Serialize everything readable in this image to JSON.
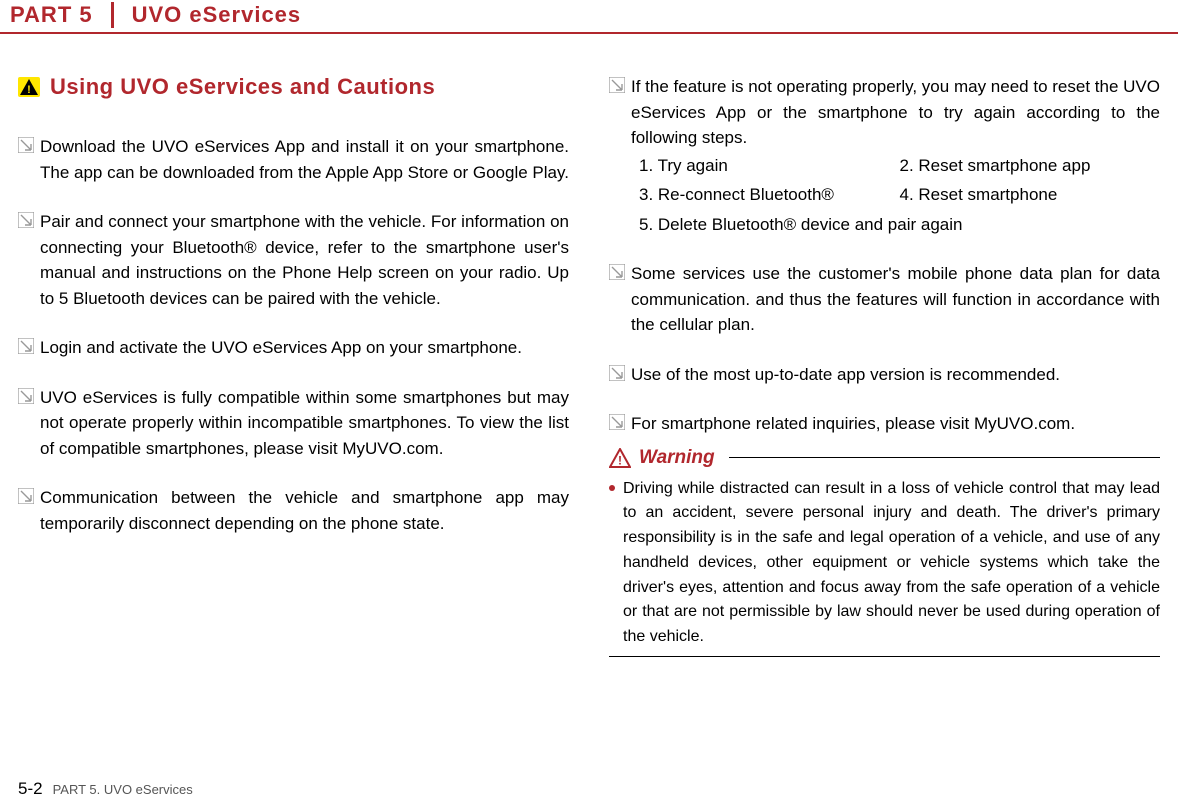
{
  "header": {
    "part_label": "PART 5",
    "part_title": "UVO eServices"
  },
  "section_heading": "Using UVO eServices and Cautions",
  "left_bullets": [
    "Download the UVO eServices App and install it on your smart­phone. The app can be downloaded from the Apple App Store or Google Play.",
    "Pair and connect your smartphone with the vehicle. For infor­mation on connecting your Bluetooth® device, refer to the smartphone user's manual and instructions on the Phone Help screen on your radio. Up to 5 Bluetooth devices can be paired with the vehicle.",
    "Login and activate the UVO eServices App on your smart­phone.",
    "UVO eServices is fully compatible within some smartphones but may not operate properly within incompatible smartphones. To view the list of compatible smartphones, please visit MyUVO.com.",
    "Communication between the vehicle and smartphone app may temporarily disconnect depending on the phone state."
  ],
  "right_intro": "If the feature is not operating properly, you may need to reset the UVO eServices App or the smartphone to try again accord­ing to the following steps.",
  "steps": {
    "s1": "1. Try again",
    "s2": "2. Reset smartphone app",
    "s3": "3. Re-connect Bluetooth®",
    "s4": "4. Reset smartphone",
    "s5": "5. Delete Bluetooth® device and pair again"
  },
  "right_bullets": [
    "Some services use the customer's mobile phone data plan for data communication. and thus the features will function in accordance with the cellular plan.",
    "Use of the most up-to-date app version is recommended.",
    "For smartphone related inquiries, please visit MyUVO.com."
  ],
  "warning": {
    "label": "Warning",
    "body": "Driving while distracted can result in a loss of vehicle control that may lead to an accident, severe personal injury and death. The driv­er's primary responsibility is in the safe and legal operation of a vehicle, and use of any handheld devices, other equipment or vehi­cle systems which take the driver's eyes, attention and focus away from the safe operation of a vehicle or that are not permissible by law should never be used during operation of the vehicle."
  },
  "footer": {
    "page_num": "5-2",
    "footer_text": "PART 5. UVO eServices"
  }
}
